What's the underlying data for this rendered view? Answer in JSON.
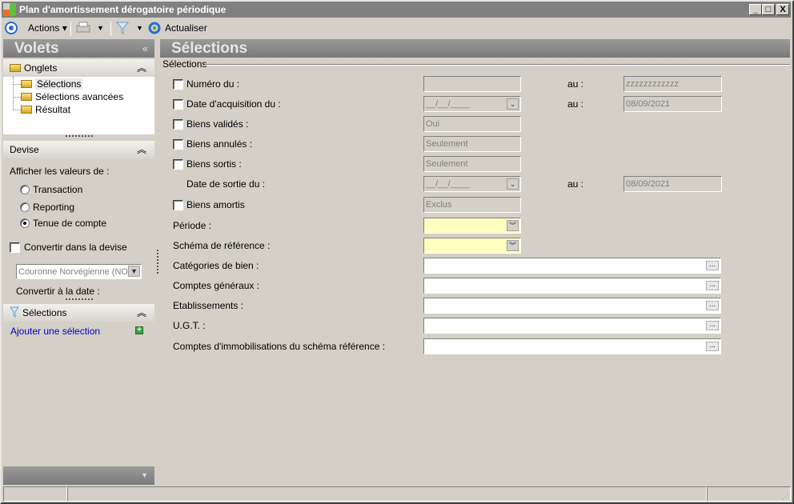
{
  "window": {
    "title": "Plan d'amortissement dérogatoire périodique",
    "min": "_",
    "max": "□",
    "close": "X"
  },
  "toolbar": {
    "actions": "Actions",
    "refresh": "Actualiser"
  },
  "left": {
    "title": "Volets",
    "collapse": "«",
    "onglets": {
      "title": "Onglets",
      "items": [
        "Sélections",
        "Sélections avancées",
        "Résultat"
      ]
    },
    "devise": {
      "title": "Devise",
      "show_label": "Afficher les valeurs de :",
      "options": [
        "Transaction",
        "Reporting",
        "Tenue de compte"
      ],
      "selected": 2,
      "convert_label": "Convertir dans la devise",
      "currency": "Couronne Norvégienne (NOK",
      "convert_date": "Convertir à la date :"
    },
    "selections": {
      "title": "Sélections",
      "add": "Ajouter une sélection"
    }
  },
  "main": {
    "title": "Sélections",
    "group": "Sélections",
    "au": "au :",
    "rows": [
      {
        "label": "Numéro du :",
        "value": "",
        "to": "zzzzzzzzzzzz"
      },
      {
        "label": "Date d'acquisition du :",
        "value": "__/__/____",
        "to": "08/09/2021"
      },
      {
        "label": "Biens validés :",
        "value": "Oui"
      },
      {
        "label": "Biens annulés :",
        "value": "Seulement"
      },
      {
        "label": "Biens sortis :",
        "value": "Seulement"
      },
      {
        "label": "Date de sortie du :",
        "value": "__/__/____",
        "to": "08/09/2021"
      },
      {
        "label": "Biens amortis",
        "value": "Exclus"
      },
      {
        "label": "Période :",
        "value": ""
      },
      {
        "label": "Schéma de référence :",
        "value": ""
      },
      {
        "label": "Catégories de bien :",
        "value": ""
      },
      {
        "label": "Comptes généraux :",
        "value": ""
      },
      {
        "label": "Etablissements :",
        "value": ""
      },
      {
        "label": "U.G.T. :",
        "value": ""
      },
      {
        "label": "Comptes d'immobilisations du schéma référence :",
        "value": ""
      }
    ]
  }
}
